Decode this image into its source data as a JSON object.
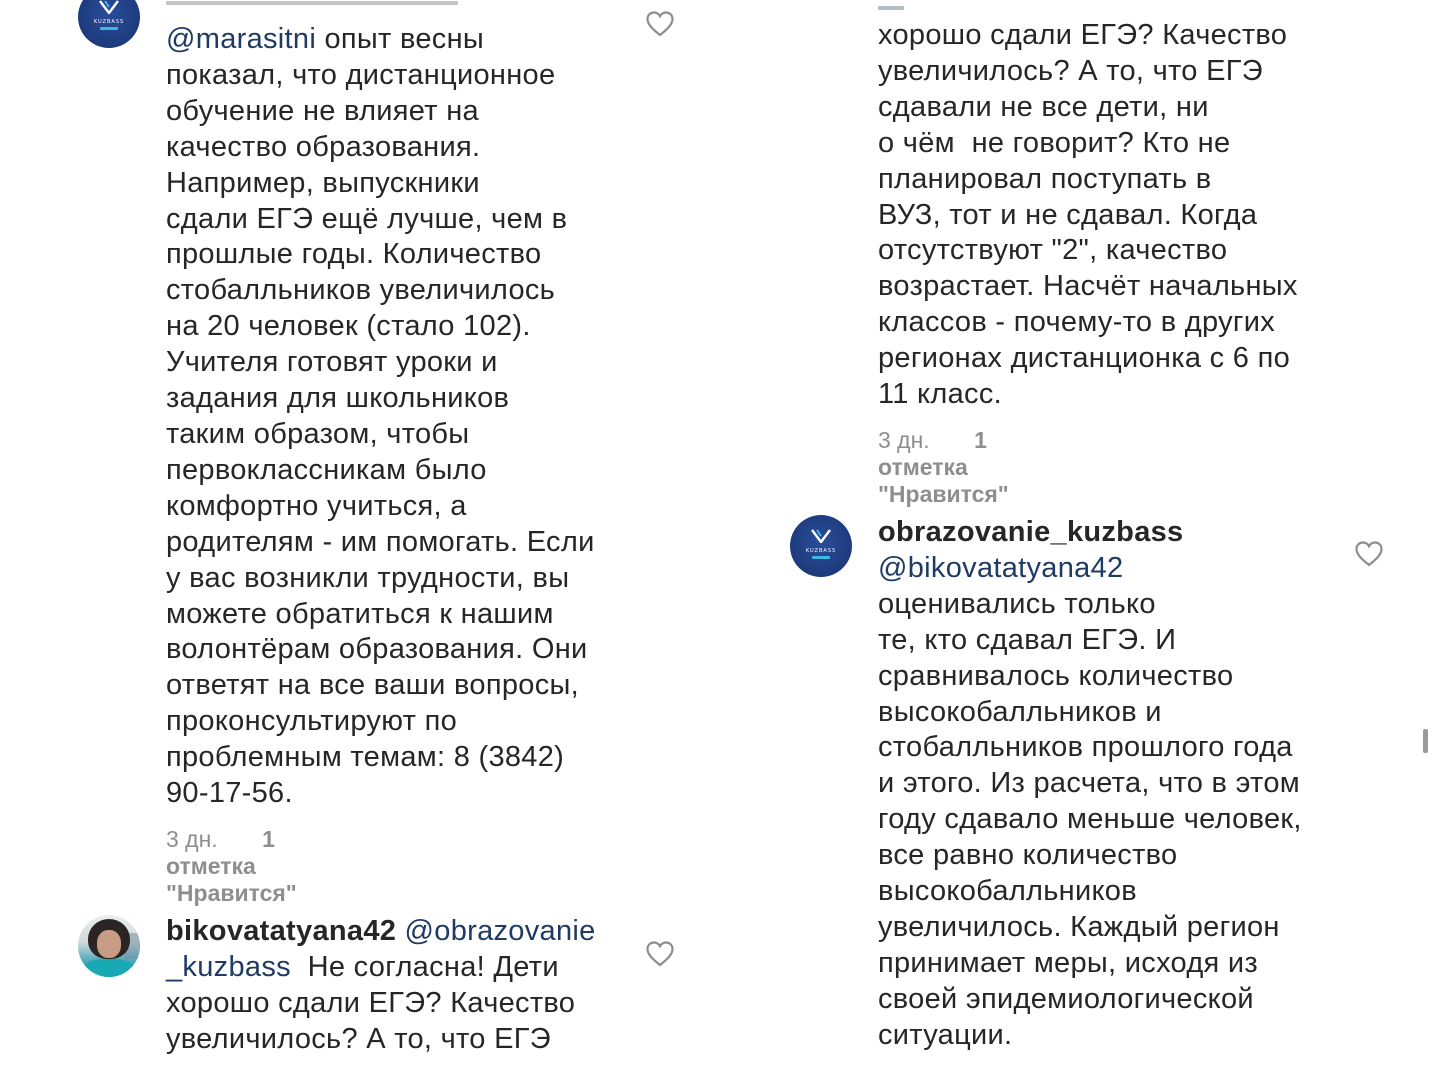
{
  "left_column": {
    "comment_1": {
      "mention": "@marasitni",
      "text": " опыт весны\nпоказал, что дистанционное\nобучение не влияет на\nкачество образования.\nНапример, выпускники\nсдали ЕГЭ ещё лучше, чем в\nпрошлые годы. Количество\nстобалльников увеличилось\nна 20 человек (стало 102).\nУчителя готовят уроки и\nзадания для школьников\nтаким образом, чтобы\nпервоклассникам было\nкомфортно учиться, а\nродителям - им помогать. Если\nу вас возникли трудности, вы\nможете обратиться к нашим\nволонтёрам образования. Они\nответят на все ваши вопросы,\nпроконсультируют по\nпроблемным темам: 8 (3842)\n90-17-56.",
      "time": "3 дн.",
      "likes": "1 отметка \"Нравится\""
    },
    "comment_2": {
      "username": "bikovatatyana42",
      "mention_part1": " @obrazovanie",
      "mention_part2": "_kuzbass",
      "text_line2": "  Не согласна! Дети",
      "text_rest": "хорошо сдали ЕГЭ? Качество\nувеличилось? А то, что ЕГЭ"
    }
  },
  "right_column": {
    "comment_1_cont": {
      "text": "хорошо сдали ЕГЭ? Качество\nувеличилось? А то, что ЕГЭ\nсдавали не все дети, ни\nо чём  не говорит? Кто не\nпланировал поступать в\nВУЗ, тот и не сдавал. Когда\nотсутствуют \"2\", качество\nвозрастает. Насчёт начальных\nклассов - почему-то в других\nрегионах дистанционка с 6 по\n11 класс.",
      "time": "3 дн.",
      "likes": "1 отметка \"Нравится\""
    },
    "comment_2": {
      "username": "obrazovanie_kuzbass",
      "mention": "@bikovatatyana42",
      "text": "оценивались только\nте, кто сдавал ЕГЭ. И\nсравнивалось количество\nвысокобалльников и\nстобалльников прошлого года\nи этого. Из расчета, что в этом\nгоду сдавало меньше человек,\nвсе равно количество\nвысокобалльников\nувеличилось. Каждый регион\nпринимает меры, исходя из\nсвоей эпидемиологической\nситуации."
    }
  },
  "avatar_brand_text": "KUZBASS",
  "icons": {
    "like": "heart-outline-icon",
    "avatar_brand": "kuzbass-logo",
    "avatar_person": "user-photo"
  },
  "colors": {
    "text": "#262626",
    "mention": "#1f3b63",
    "meta": "#8e8e8e",
    "brand_avatar": "#1d3a7c",
    "heart": "#8e8e8e"
  }
}
